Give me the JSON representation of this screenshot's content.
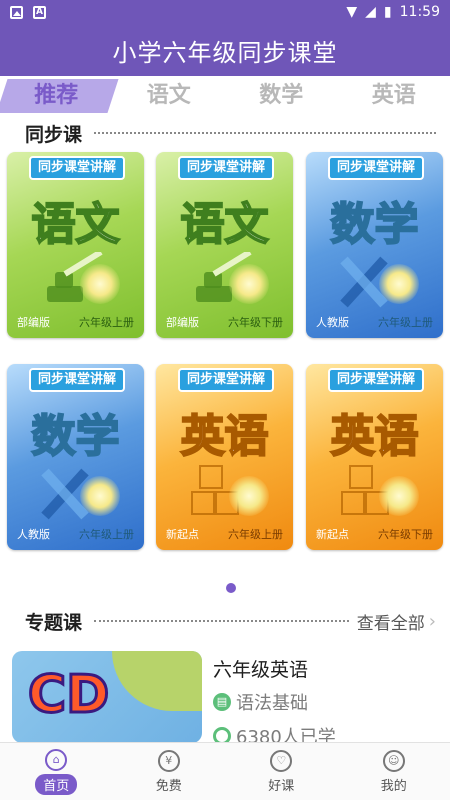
{
  "status_bar": {
    "time": "11:59"
  },
  "header": {
    "title": "小学六年级同步课堂"
  },
  "tabs": [
    {
      "label": "推荐",
      "active": true
    },
    {
      "label": "语文",
      "active": false
    },
    {
      "label": "数学",
      "active": false
    },
    {
      "label": "英语",
      "active": false
    }
  ],
  "sync_section": {
    "label": "同步课"
  },
  "cards": [
    {
      "banner": "同步课堂讲解",
      "subject": "语文",
      "publisher": "部编版",
      "grade": "六年级上册"
    },
    {
      "banner": "同步课堂讲解",
      "subject": "语文",
      "publisher": "部编版",
      "grade": "六年级下册"
    },
    {
      "banner": "同步课堂讲解",
      "subject": "数学",
      "publisher": "人教版",
      "grade": "六年级上册"
    },
    {
      "banner": "同步课堂讲解",
      "subject": "数学",
      "publisher": "人教版",
      "grade": "六年级上册"
    },
    {
      "banner": "同步课堂讲解",
      "subject": "英语",
      "publisher": "新起点",
      "grade": "六年级上册"
    },
    {
      "banner": "同步课堂讲解",
      "subject": "英语",
      "publisher": "新起点",
      "grade": "六年级下册"
    }
  ],
  "topic_section": {
    "label": "专题课",
    "more_label": "查看全部"
  },
  "topic": {
    "image_text": "CD",
    "title": "六年级英语",
    "tag": "语法基础",
    "learners": "6380人已学"
  },
  "bottom_nav": [
    {
      "label": "首页",
      "icon": "home-icon",
      "active": true
    },
    {
      "label": "免费",
      "icon": "yuan-icon",
      "active": false
    },
    {
      "label": "好课",
      "icon": "heart-icon",
      "active": false
    },
    {
      "label": "我的",
      "icon": "face-icon",
      "active": false
    }
  ],
  "colors": {
    "primary": "#6f56b8",
    "accent": "#7a5bc9"
  }
}
